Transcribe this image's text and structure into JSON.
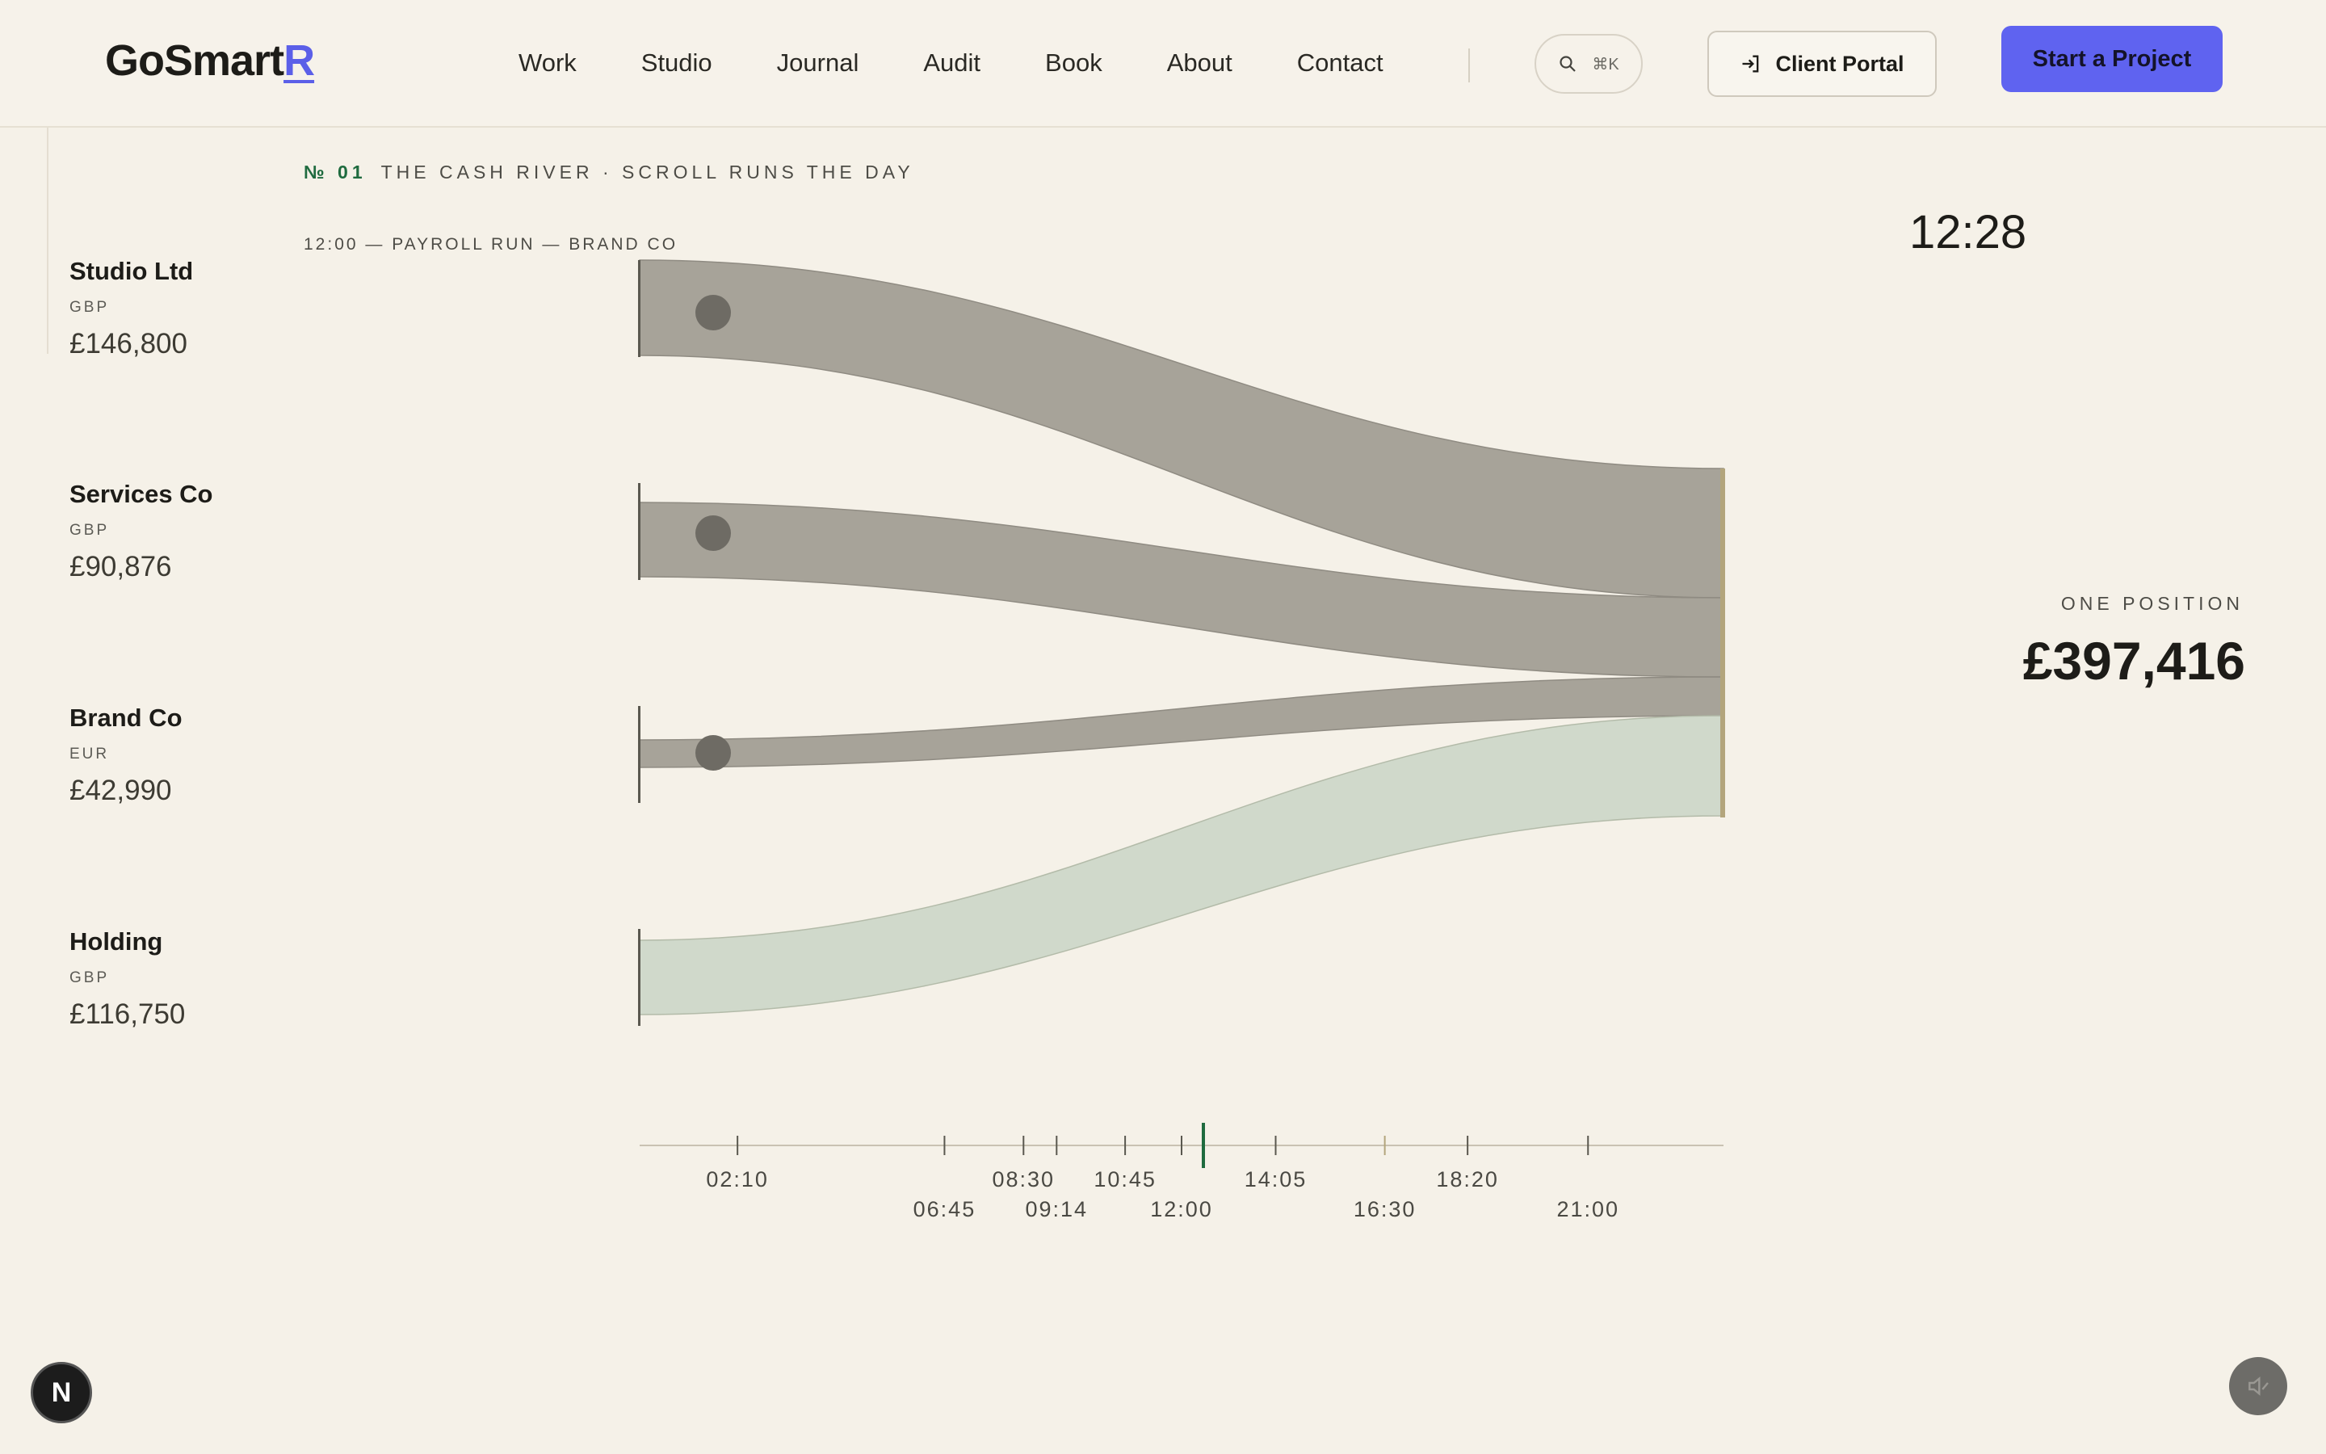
{
  "progress": {
    "fraction": 0.134
  },
  "header": {
    "logo_main": "GoSmart",
    "logo_accent": "R",
    "nav": [
      "Work",
      "Studio",
      "Journal",
      "Audit",
      "Book",
      "About",
      "Contact"
    ],
    "search_shortcut": "⌘K",
    "client_portal": "Client Portal",
    "start_project": "Start a Project"
  },
  "section": {
    "number": "№ 01",
    "title": "THE CASH RIVER · SCROLL RUNS THE DAY",
    "event": "12:00 — PAYROLL RUN — BRAND CO"
  },
  "accounts": [
    {
      "name": "Studio Ltd",
      "currency": "GBP",
      "amount": "£146,800"
    },
    {
      "name": "Services Co",
      "currency": "GBP",
      "amount": "£90,876"
    },
    {
      "name": "Brand Co",
      "currency": "EUR",
      "amount": "£42,990"
    },
    {
      "name": "Holding",
      "currency": "GBP",
      "amount": "£116,750"
    }
  ],
  "clock": "12:28",
  "position": {
    "label": "ONE POSITION",
    "amount": "£397,416"
  },
  "timeline": {
    "ticks": [
      "02:10",
      "06:45",
      "08:30",
      "09:14",
      "10:45",
      "12:00",
      "14:05",
      "16:30",
      "18:20",
      "21:00"
    ],
    "current": "12:28"
  },
  "colors": {
    "accent": "#5f63f0",
    "flow": "#a7a399",
    "holding_flow": "#d0d9cb",
    "cursor": "#1f6b3f"
  },
  "badge": "N"
}
